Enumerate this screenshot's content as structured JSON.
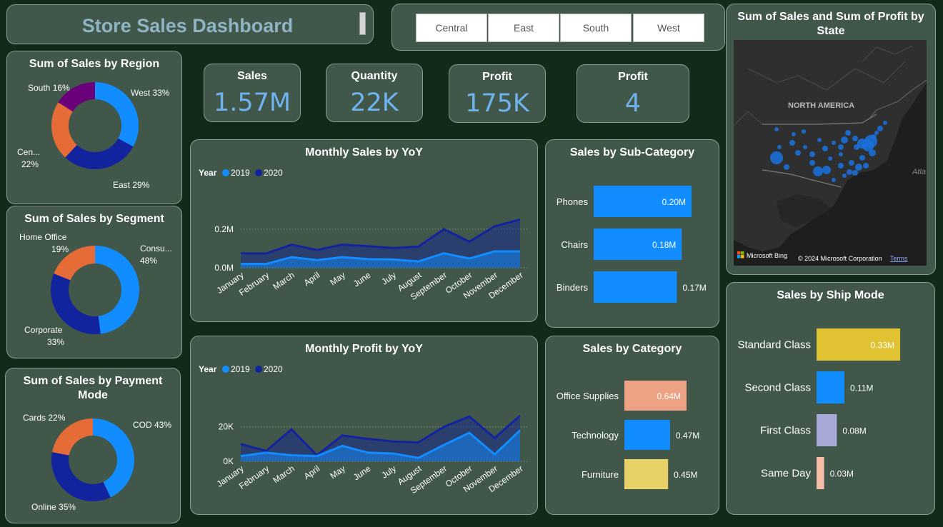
{
  "header": {
    "title": "Store Sales Dashboard"
  },
  "region_slicer": {
    "options": [
      "Central",
      "East",
      "South",
      "West"
    ]
  },
  "kpis": [
    {
      "label": "Sales",
      "value": "1.57M"
    },
    {
      "label": "Quantity",
      "value": "22K"
    },
    {
      "label": "Profit",
      "value": "175K"
    },
    {
      "label": "Profit",
      "value": "4"
    }
  ],
  "colors": {
    "background": "#132a18",
    "card": "#41574a",
    "blue_light": "#118dff",
    "blue_dark": "#12239e",
    "orange": "#e66c37",
    "purple": "#6b007b",
    "yellow": "#e1c233",
    "salmon": "#eda383",
    "kpi_value": "#6fb3ee"
  },
  "chart_data": [
    {
      "id": "region",
      "type": "pie",
      "title": "Sum of Sales by Region",
      "slices": [
        {
          "name": "West",
          "label": "West 33%",
          "value": 33,
          "color": "#118dff"
        },
        {
          "name": "East",
          "label": "East 29%",
          "value": 29,
          "color": "#12239e"
        },
        {
          "name": "Central",
          "label": "Cen... 22%",
          "value": 22,
          "color": "#e66c37"
        },
        {
          "name": "South",
          "label": "South 16%",
          "value": 16,
          "color": "#6b007b"
        }
      ]
    },
    {
      "id": "segment",
      "type": "pie",
      "title": "Sum of Sales by Segment",
      "slices": [
        {
          "name": "Consumer",
          "label": "Consu... 48%",
          "value": 48,
          "color": "#118dff"
        },
        {
          "name": "Corporate",
          "label": "Corporate 33%",
          "value": 33,
          "color": "#12239e"
        },
        {
          "name": "Home Office",
          "label": "Home Office 19%",
          "value": 19,
          "color": "#e66c37"
        }
      ]
    },
    {
      "id": "payment",
      "type": "pie",
      "title": "Sum of Sales by Payment Mode",
      "slices": [
        {
          "name": "COD",
          "label": "COD 43%",
          "value": 43,
          "color": "#118dff"
        },
        {
          "name": "Online",
          "label": "Online 35%",
          "value": 35,
          "color": "#12239e"
        },
        {
          "name": "Cards",
          "label": "Cards 22%",
          "value": 22,
          "color": "#e66c37"
        }
      ]
    },
    {
      "id": "monthly_sales",
      "type": "area",
      "title": "Monthly Sales by YoY",
      "legend_title": "Year",
      "categories": [
        "January",
        "February",
        "March",
        "April",
        "May",
        "June",
        "July",
        "August",
        "September",
        "October",
        "November",
        "December"
      ],
      "y_ticks": [
        {
          "value": 0,
          "label": "0.0M"
        },
        {
          "value": 0.2,
          "label": "0.2M"
        }
      ],
      "ylim": [
        0,
        0.27
      ],
      "series": [
        {
          "name": "2019",
          "color": "#118dff",
          "values": [
            0.02,
            0.02,
            0.055,
            0.04,
            0.055,
            0.045,
            0.043,
            0.033,
            0.075,
            0.048,
            0.085,
            0.085
          ]
        },
        {
          "name": "2020",
          "color": "#12239e",
          "values": [
            0.075,
            0.074,
            0.12,
            0.092,
            0.12,
            0.112,
            0.102,
            0.11,
            0.2,
            0.135,
            0.215,
            0.25
          ]
        }
      ]
    },
    {
      "id": "monthly_profit",
      "type": "area",
      "title": "Monthly Profit by YoY",
      "legend_title": "Year",
      "categories": [
        "January",
        "February",
        "March",
        "April",
        "May",
        "June",
        "July",
        "August",
        "September",
        "October",
        "November",
        "December"
      ],
      "y_ticks": [
        {
          "value": 0,
          "label": "0K"
        },
        {
          "value": 20000,
          "label": "20K"
        }
      ],
      "ylim": [
        0,
        29000
      ],
      "series": [
        {
          "name": "2019",
          "color": "#118dff",
          "values": [
            3000,
            5000,
            3500,
            3000,
            9000,
            5000,
            4500,
            2000,
            9500,
            16500,
            4000,
            18000
          ]
        },
        {
          "name": "2020",
          "color": "#12239e",
          "values": [
            10000,
            6000,
            18500,
            3500,
            15000,
            13000,
            11500,
            11000,
            20000,
            26000,
            13500,
            26500
          ]
        }
      ]
    },
    {
      "id": "subcategory",
      "type": "bar",
      "title": "Sales by Sub-Category",
      "categories": [
        "Phones",
        "Chairs",
        "Binders"
      ],
      "values": [
        0.2,
        0.18,
        0.17
      ],
      "labels": [
        "0.20M",
        "0.18M",
        "0.17M"
      ],
      "colors": [
        "#118dff",
        "#118dff",
        "#118dff"
      ],
      "xlim": [
        0,
        0.2
      ]
    },
    {
      "id": "category",
      "type": "bar",
      "title": "Sales by Category",
      "categories": [
        "Office Supplies",
        "Technology",
        "Furniture"
      ],
      "values": [
        0.64,
        0.47,
        0.45
      ],
      "labels": [
        "0.64M",
        "0.47M",
        "0.45M"
      ],
      "colors": [
        "#eda383",
        "#118dff",
        "#e8d166"
      ],
      "xlim": [
        0,
        0.64
      ]
    },
    {
      "id": "shipmode",
      "type": "bar",
      "title": "Sales by Ship Mode",
      "categories": [
        "Standard Class",
        "Second Class",
        "First Class",
        "Same Day"
      ],
      "values": [
        0.33,
        0.11,
        0.08,
        0.03
      ],
      "labels": [
        "0.33M",
        "0.11M",
        "0.08M",
        "0.03M"
      ],
      "colors": [
        "#e1c233",
        "#118dff",
        "#a7a9d8",
        "#f5bca8"
      ],
      "xlim": [
        0,
        0.33
      ]
    }
  ],
  "map": {
    "title": "Sum of Sales and Sum of Profit by State",
    "continent_label": "NORTH AMERICA",
    "ocean_label": "Atla",
    "bing_label": "Microsoft Bing",
    "copyright": "© 2024 Microsoft Corporation",
    "terms_link": "Terms",
    "bubble_color": "#1a6fd8"
  }
}
